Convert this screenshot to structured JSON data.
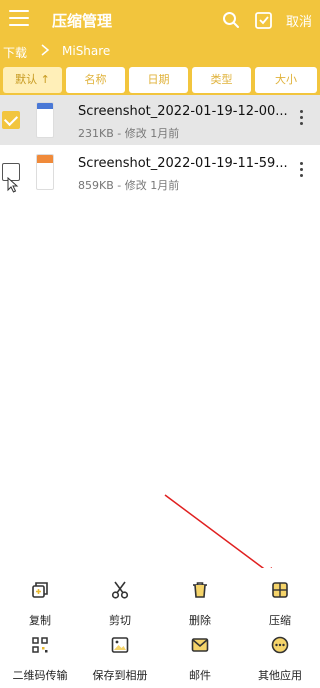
{
  "header": {
    "title": "压缩管理",
    "cancel_label": "取消"
  },
  "breadcrumb": {
    "items": [
      "下载",
      "MiShare"
    ]
  },
  "sort_tabs": [
    {
      "label": "默认 ↑",
      "active": true
    },
    {
      "label": "名称",
      "active": false
    },
    {
      "label": "日期",
      "active": false
    },
    {
      "label": "类型",
      "active": false
    },
    {
      "label": "大小",
      "active": false
    }
  ],
  "files": [
    {
      "name": "Screenshot_2022-01-19-12-00...",
      "meta": "231KB - 修改 1月前",
      "checked": true
    },
    {
      "name": "Screenshot_2022-01-19-11-59...",
      "meta": "859KB - 修改 1月前",
      "checked": false
    }
  ],
  "actions": [
    {
      "label": "复制",
      "icon": "copy-icon"
    },
    {
      "label": "剪切",
      "icon": "scissors-icon"
    },
    {
      "label": "删除",
      "icon": "trash-icon"
    },
    {
      "label": "压缩",
      "icon": "compress-icon"
    },
    {
      "label": "二维码传输",
      "icon": "qrcode-icon"
    },
    {
      "label": "保存到相册",
      "icon": "image-icon"
    },
    {
      "label": "邮件",
      "icon": "mail-icon"
    },
    {
      "label": "其他应用",
      "icon": "more-apps-icon"
    }
  ],
  "colors": {
    "brand": "#f2c53d",
    "arrow": "#e02020"
  }
}
